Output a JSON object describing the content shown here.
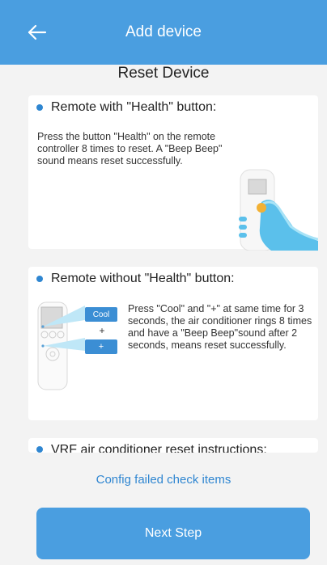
{
  "header": {
    "back_icon": "back-arrow-icon",
    "title": "Add device"
  },
  "page": {
    "title": "Reset Device"
  },
  "cards": [
    {
      "title": "Remote with \"Health\" button:",
      "text": "Press the button \"Health\" on the remote controller 8 times to reset. A \"Beep Beep\" sound means reset successfully.",
      "illustration": "remote-with-hand"
    },
    {
      "title": "Remote without \"Health\" button:",
      "text": "Press \"Cool\" and \"+\" at same time for 3 seconds, the air conditioner rings 8 times and have a  \"Beep Beep\"sound after 2 seconds, means reset successfully.",
      "illustration": "remote-cool-plus",
      "labels": {
        "cool": "Cool",
        "plus_text": "+",
        "plus_button": "+"
      }
    },
    {
      "title": "VRF air conditioner reset instructions:"
    }
  ],
  "footer": {
    "link": "Config failed check items",
    "button": "Next Step"
  },
  "colors": {
    "primary": "#4a9ee0",
    "link": "#2f86d1",
    "background": "#f3f3f3"
  }
}
